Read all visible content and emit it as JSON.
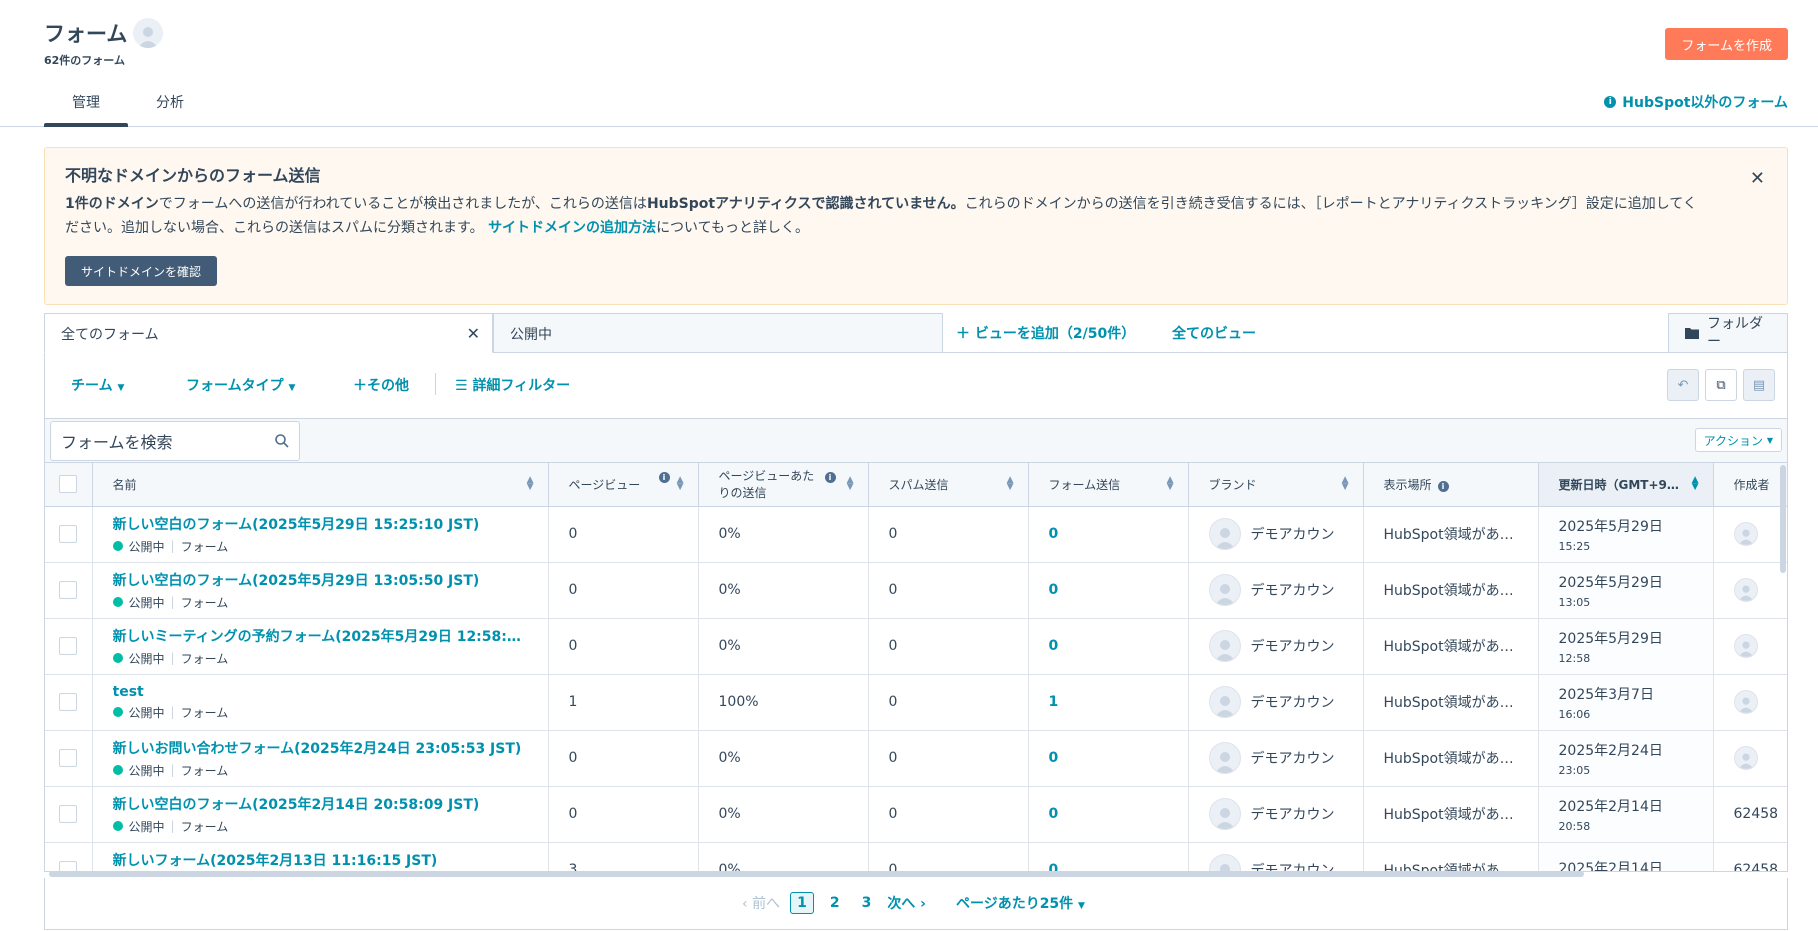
{
  "header": {
    "title": "フォーム",
    "count": "62件のフォーム",
    "create_button": "フォームを作成"
  },
  "main_tabs": {
    "manage": "管理",
    "analyze": "分析",
    "external_forms": "HubSpot以外のフォーム"
  },
  "alert": {
    "title": "不明なドメインからのフォーム送信",
    "part1_bold": "1件のドメイン",
    "part2": "でフォームへの送信が行われていることが検出されましたが、これらの送信は",
    "part3_bold": "HubSpotアナリティクスで認識されていません。",
    "part4": "これらのドメインからの送信を引き続き受信するには、［レポートとアナリティクストラッキング］設定に追加してください。追加しない場合、これらの送信はスパムに分類されます。",
    "link": "サイトドメインの追加方法",
    "part5": "についてもっと詳しく。",
    "button": "サイトドメインを確認"
  },
  "view_tabs": {
    "all_forms": "全てのフォーム",
    "published": "公開中",
    "add_view": "ビューを追加（2/50件）",
    "all_views": "全てのビュー",
    "folder": "フォルダー"
  },
  "filters": {
    "team": "チーム",
    "form_type": "フォームタイプ",
    "more": "その他",
    "advanced": "詳細フィルター"
  },
  "search": {
    "placeholder": "フォームを検索"
  },
  "actions_label": "アクション",
  "columns": {
    "name": "名前",
    "pageviews": "ページビュー",
    "submission_rate": "ページビューあたりの送信",
    "spam": "スパム送信",
    "submissions": "フォーム送信",
    "brand": "ブランド",
    "location": "表示場所",
    "updated": "更新日時（GMT+9…",
    "creator": "作成者"
  },
  "rows": [
    {
      "name": "新しい空白のフォーム(2025年5月29日 15:25:10 JST)",
      "status": "公開中",
      "type": "フォーム",
      "pageviews": "0",
      "rate": "0%",
      "spam": "0",
      "submissions": "0",
      "brand": "デモアカウン",
      "location": "HubSpot領域があ…",
      "date": "2025年5月29日",
      "time": "15:25",
      "creator": ""
    },
    {
      "name": "新しい空白のフォーム(2025年5月29日 13:05:50 JST)",
      "status": "公開中",
      "type": "フォーム",
      "pageviews": "0",
      "rate": "0%",
      "spam": "0",
      "submissions": "0",
      "brand": "デモアカウン",
      "location": "HubSpot領域があ…",
      "date": "2025年5月29日",
      "time": "13:05",
      "creator": ""
    },
    {
      "name": "新しいミーティングの予約フォーム(2025年5月29日 12:58:18 …",
      "status": "公開中",
      "type": "フォーム",
      "pageviews": "0",
      "rate": "0%",
      "spam": "0",
      "submissions": "0",
      "brand": "デモアカウン",
      "location": "HubSpot領域があ…",
      "date": "2025年5月29日",
      "time": "12:58",
      "creator": ""
    },
    {
      "name": "test",
      "status": "公開中",
      "type": "フォーム",
      "pageviews": "1",
      "rate": "100%",
      "spam": "0",
      "submissions": "1",
      "brand": "デモアカウン",
      "location": "HubSpot領域があ…",
      "date": "2025年3月7日",
      "time": "16:06",
      "creator": ""
    },
    {
      "name": "新しいお問い合わせフォーム(2025年2月24日 23:05:53 JST)",
      "status": "公開中",
      "type": "フォーム",
      "pageviews": "0",
      "rate": "0%",
      "spam": "0",
      "submissions": "0",
      "brand": "デモアカウン",
      "location": "HubSpot領域があ…",
      "date": "2025年2月24日",
      "time": "23:05",
      "creator": ""
    },
    {
      "name": "新しい空白のフォーム(2025年2月14日 20:58:09 JST)",
      "status": "公開中",
      "type": "フォーム",
      "pageviews": "0",
      "rate": "0%",
      "spam": "0",
      "submissions": "0",
      "brand": "デモアカウン",
      "location": "HubSpot領域があ…",
      "date": "2025年2月14日",
      "time": "20:58",
      "creator": "62458"
    },
    {
      "name": "新しいフォーム(2025年2月13日 11:16:15 JST)",
      "status": "公開中",
      "type": "フォーム",
      "pageviews": "3",
      "rate": "0%",
      "spam": "0",
      "submissions": "0",
      "brand": "デモアカウン",
      "location": "HubSpot領域があ…",
      "date": "2025年2月14日",
      "time": "",
      "creator": "62458"
    }
  ],
  "pagination": {
    "prev": "前へ",
    "pages": [
      "1",
      "2",
      "3"
    ],
    "next": "次へ",
    "per_page": "ページあたり25件"
  }
}
